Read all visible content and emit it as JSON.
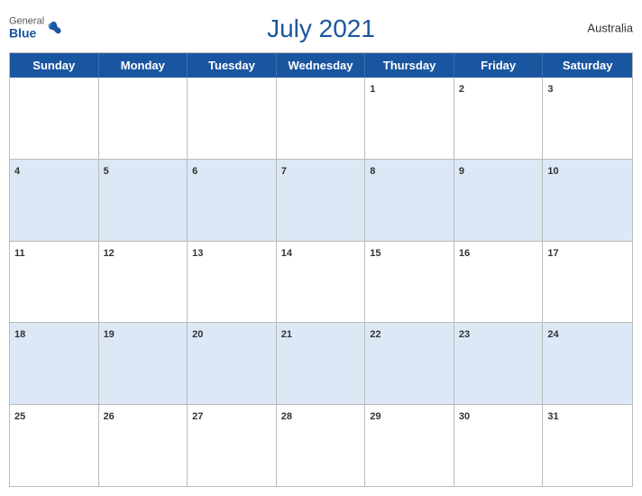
{
  "header": {
    "title": "July 2021",
    "country": "Australia",
    "logo": {
      "general": "General",
      "blue": "Blue"
    }
  },
  "days": {
    "headers": [
      "Sunday",
      "Monday",
      "Tuesday",
      "Wednesday",
      "Thursday",
      "Friday",
      "Saturday"
    ]
  },
  "weeks": [
    [
      null,
      null,
      null,
      null,
      1,
      2,
      3
    ],
    [
      4,
      5,
      6,
      7,
      8,
      9,
      10
    ],
    [
      11,
      12,
      13,
      14,
      15,
      16,
      17
    ],
    [
      18,
      19,
      20,
      21,
      22,
      23,
      24
    ],
    [
      25,
      26,
      27,
      28,
      29,
      30,
      31
    ]
  ]
}
